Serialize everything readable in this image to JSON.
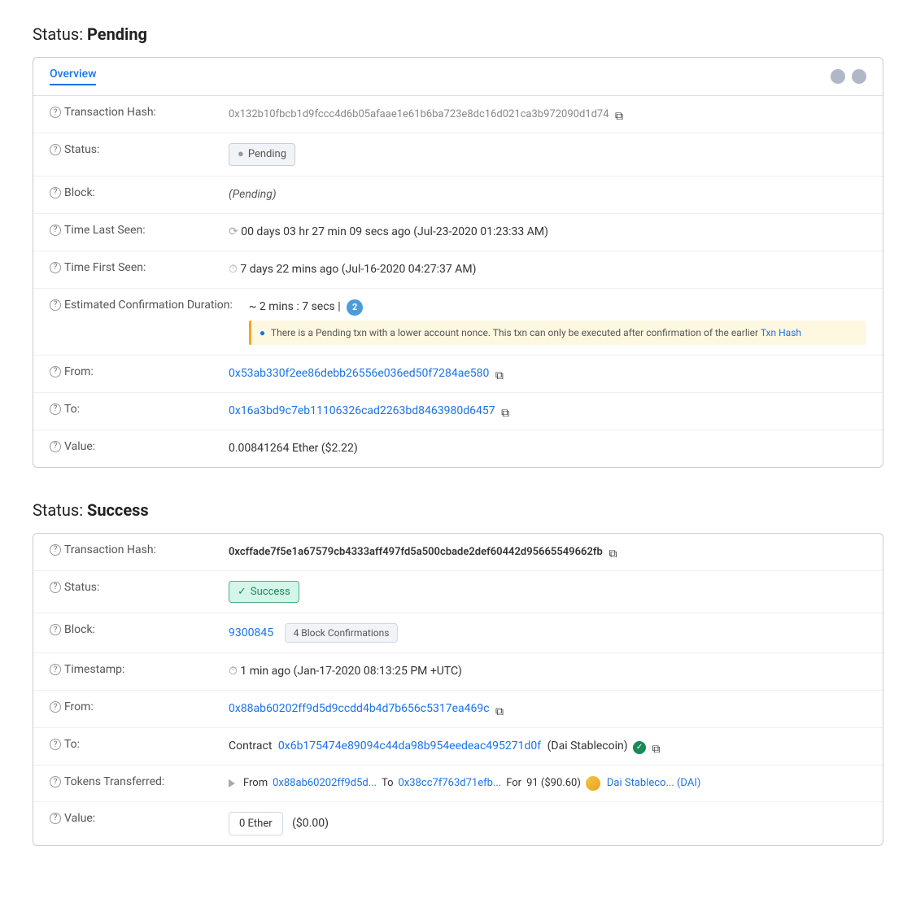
{
  "pending_section": {
    "title": "Status:",
    "title_bold": "Pending",
    "tab_label": "Overview",
    "transaction_hash_label": "Transaction Hash:",
    "transaction_hash_value": "0x132b10fbcb1d9fccc4d6b05afaae1e61b6ba723e8dc16d021ca3b972090d1d74",
    "status_label": "Status:",
    "status_value": "Pending",
    "block_label": "Block:",
    "block_value": "(Pending)",
    "time_last_seen_label": "Time Last Seen:",
    "time_last_seen_value": "00 days 03 hr 27 min 09 secs ago (Jul-23-2020 01:23:33 AM)",
    "time_first_seen_label": "Time First Seen:",
    "time_first_seen_value": "7 days 22 mins ago (Jul-16-2020 04:27:37 AM)",
    "estimated_label": "Estimated Confirmation Duration:",
    "estimated_value": "~ 2 mins : 7 secs |",
    "warning_text": "There is a Pending txn with a lower account nonce. This txn can only be executed after confirmation of the earlier Txn Hash",
    "from_label": "From:",
    "from_value": "0x53ab330f2ee86debb26556e036ed50f7284ae580",
    "to_label": "To:",
    "to_value": "0x16a3bd9c7eb11106326cad2263bd8463980d6457",
    "value_label": "Value:",
    "value_amount": "0.00841264 Ether ($2.22)"
  },
  "success_section": {
    "title": "Status:",
    "title_bold": "Success",
    "transaction_hash_label": "Transaction Hash:",
    "transaction_hash_value": "0xcffade7f5e1a67579cb4333aff497fd5a500cbade2def60442d95665549662fb",
    "status_label": "Status:",
    "status_value": "Success",
    "block_label": "Block:",
    "block_number": "9300845",
    "block_confirmations": "4 Block Confirmations",
    "timestamp_label": "Timestamp:",
    "timestamp_value": "1 min ago (Jan-17-2020 08:13:25 PM +UTC)",
    "from_label": "From:",
    "from_value": "0x88ab60202ff9d5d9ccdd4b4d7b656c5317ea469c",
    "to_label": "To:",
    "to_prefix": "Contract",
    "to_contract_value": "0x6b175474e89094c44da98b954eedeac495271d0f",
    "to_contract_name": "(Dai Stablecoin)",
    "tokens_label": "Tokens Transferred:",
    "tokens_from_prefix": "From",
    "tokens_from_addr": "0x88ab60202ff9d5d...",
    "tokens_to_prefix": "To",
    "tokens_to_addr": "0x38cc7f763d71efb...",
    "tokens_for_prefix": "For",
    "tokens_amount": "91 ($90.60)",
    "tokens_name": "Dai Stableco... (DAI)",
    "value_label": "Value:",
    "value_amount": "0 Ether",
    "value_usd": "($0.00)"
  },
  "icons": {
    "help": "?",
    "copy": "⧉",
    "clock": "⏱",
    "check": "✓",
    "circle_pending": "●",
    "circle_check": "✓"
  }
}
